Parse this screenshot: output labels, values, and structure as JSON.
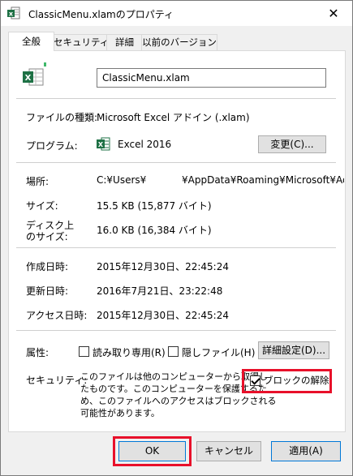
{
  "window": {
    "title": "ClassicMenu.xlamのプロパティ",
    "close_glyph": "✕"
  },
  "tabs": [
    {
      "label": "全般",
      "active": true
    },
    {
      "label": "セキュリティ",
      "active": false
    },
    {
      "label": "詳細",
      "active": false
    },
    {
      "label": "以前のバージョン",
      "active": false
    }
  ],
  "general": {
    "file_name": "ClassicMenu.xlam",
    "file_type_label": "ファイルの種類:",
    "file_type_value": "Microsoft Excel アドイン (.xlam)",
    "program_label": "プログラム:",
    "program_value": "Excel 2016",
    "change_button": "変更(C)...",
    "location_label": "場所:",
    "location_prefix": "C:¥Users¥",
    "location_suffix": "¥AppData¥Roaming¥Microsoft¥Add",
    "size_label": "サイズ:",
    "size_value": "15.5 KB (15,877 バイト)",
    "size_on_disk_label_line1": "ディスク上",
    "size_on_disk_label_line2": "のサイズ:",
    "size_on_disk_value": "16.0 KB (16,384 バイト)",
    "created_label": "作成日時:",
    "created_value": "2015年12月30日、22:45:24",
    "modified_label": "更新日時:",
    "modified_value": "2016年7月21日、23:22:48",
    "accessed_label": "アクセス日時:",
    "accessed_value": "2015年12月30日、22:45:24",
    "attributes_label": "属性:",
    "readonly_label": "読み取り専用(R)",
    "readonly_checked": false,
    "hidden_label": "隠しファイル(H)",
    "hidden_checked": false,
    "advanced_button": "詳細設定(D)...",
    "security_label": "セキュリティ:",
    "security_text": [
      "このファイルは他のコンピューターから取得し",
      "たものです。このコンピューターを保護するた",
      "め、このファイルへのアクセスはブロックされる",
      "可能性があります。"
    ],
    "unblock_label": "ブロックの解除(K",
    "unblock_checked": true
  },
  "footer": {
    "ok": "OK",
    "cancel": "キャンセル",
    "apply": "適用(A)"
  },
  "colors": {
    "highlight_red": "#e8102a",
    "excel_green": "#1e7145"
  },
  "icons": {
    "window": "excel-file-icon",
    "file": "excel-file-icon",
    "program": "excel-icon"
  }
}
